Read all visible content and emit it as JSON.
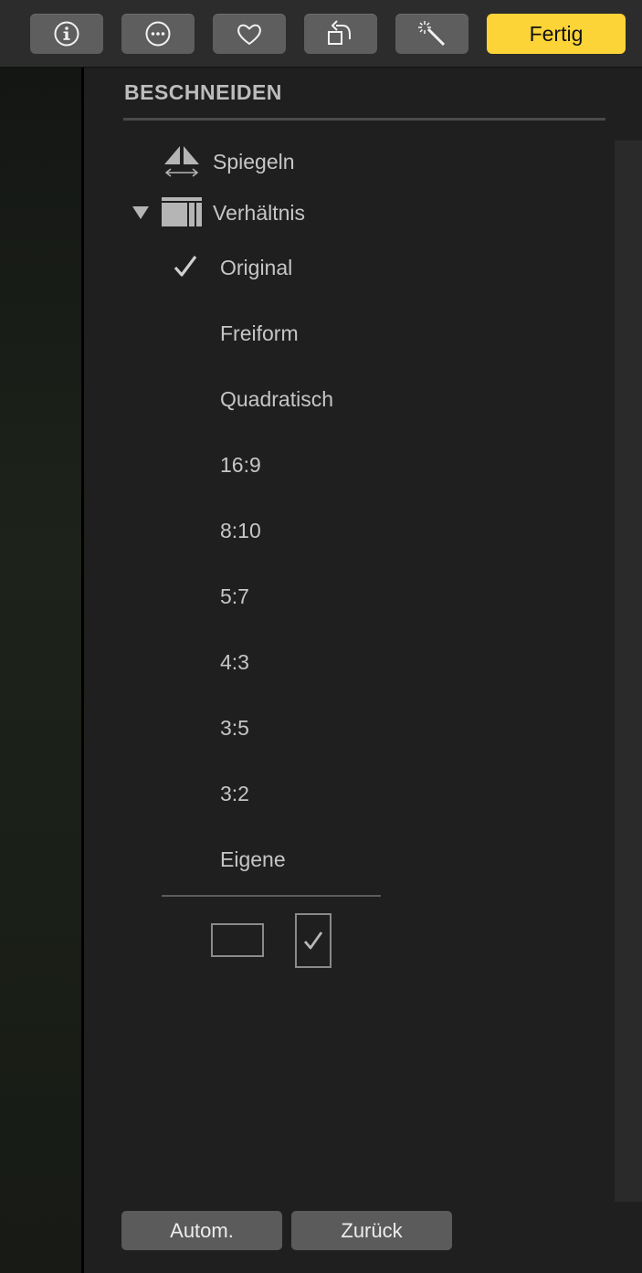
{
  "toolbar": {
    "buttons": [
      {
        "icon": "info-icon"
      },
      {
        "icon": "more-icon"
      },
      {
        "icon": "heart-icon"
      },
      {
        "icon": "rotate-icon"
      },
      {
        "icon": "magic-wand-icon"
      }
    ],
    "done_label": "Fertig",
    "done_color": "#fdd437"
  },
  "panel": {
    "title": "BESCHNEIDEN",
    "flip_label": "Spiegeln",
    "aspect_label": "Verhältnis",
    "aspect_expanded": true,
    "selected_ratio": "Original",
    "ratios": [
      "Original",
      "Freiform",
      "Quadratisch",
      "16:9",
      "8:10",
      "5:7",
      "4:3",
      "3:5",
      "3:2",
      "Eigene"
    ],
    "orientation_selected": "portrait"
  },
  "footer": {
    "auto_label": "Autom.",
    "reset_label": "Zurück"
  }
}
